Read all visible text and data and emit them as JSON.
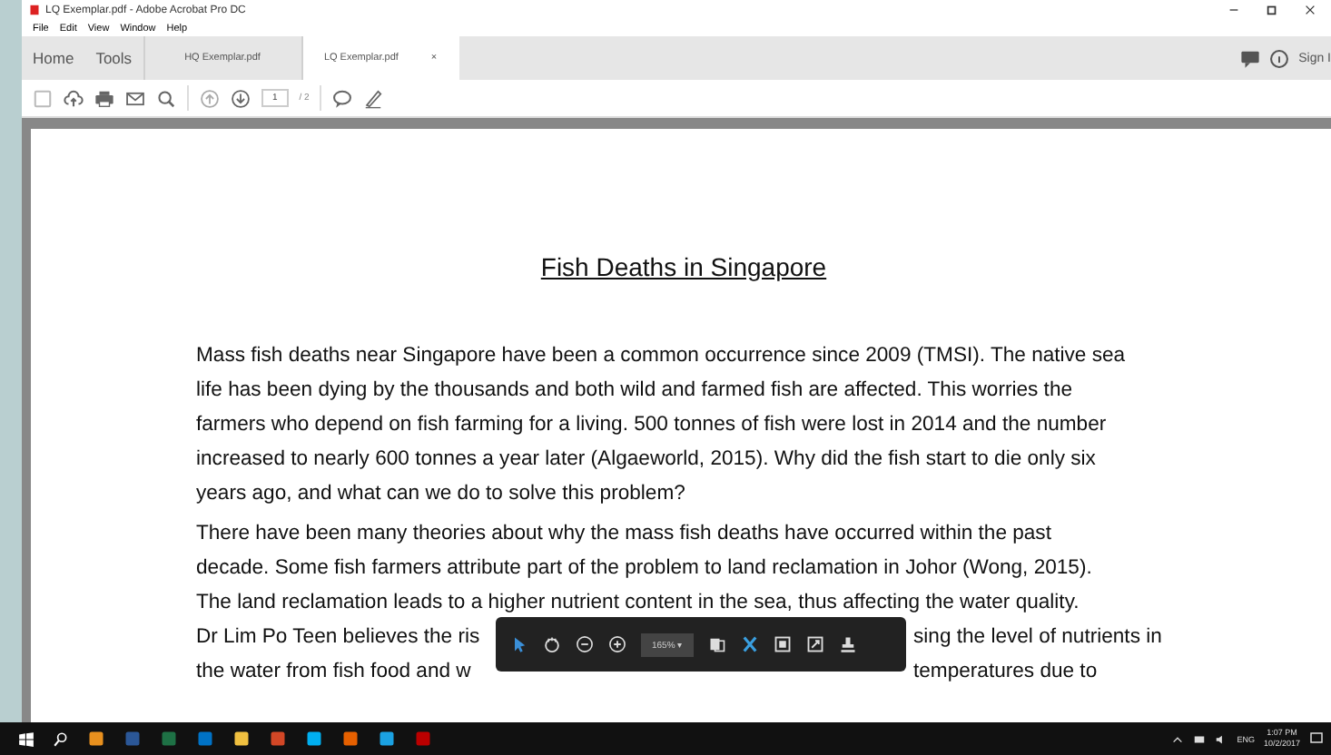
{
  "window": {
    "title": "LQ Exemplar.pdf - Adobe Acrobat Pro DC"
  },
  "menu": [
    "File",
    "Edit",
    "View",
    "Window",
    "Help"
  ],
  "nav": [
    "Home",
    "Tools"
  ],
  "tabs": [
    {
      "label": "HQ Exemplar.pdf",
      "selected": false,
      "closable": false
    },
    {
      "label": "LQ Exemplar.pdf",
      "selected": true,
      "closable": true
    }
  ],
  "tab_close": "×",
  "sign_in": "Sign I",
  "page": {
    "current": "1",
    "total": "/ 2"
  },
  "document": {
    "title": "Fish Deaths in Singapore",
    "paragraphs": [
      "Mass fish deaths near Singapore have been a common occurrence since 2009 (TMSI). The native sea life has been dying by the thousands and both wild and farmed fish are affected. This worries the farmers who depend on fish farming for a living. 500 tonnes of fish were lost in 2014 and the number increased to nearly 600 tonnes a year later (Algaeworld, 2015). Why did the fish start to die only six years ago, and what can we do to solve this problem?",
      "There have been many theories about why the mass fish deaths have occurred within the past decade. Some fish farmers attribute part of the problem to land reclamation in Johor (Wong, 2015). The land reclamation leads to a higher nutrient content in the sea, thus affecting the water quality."
    ],
    "covered_lines": [
      {
        "left": "Dr Lim Po Teen believes the ris",
        "right": "sing the level of nutrients in"
      },
      {
        "left": "the water from fish food and w",
        "right": "temperatures due to"
      }
    ]
  },
  "zoom_toolbar": {
    "zoom": "165%",
    "caret": "▾"
  },
  "taskbar": {
    "language": "ENG",
    "time": "1:07 PM",
    "date": "10/2/2017"
  }
}
